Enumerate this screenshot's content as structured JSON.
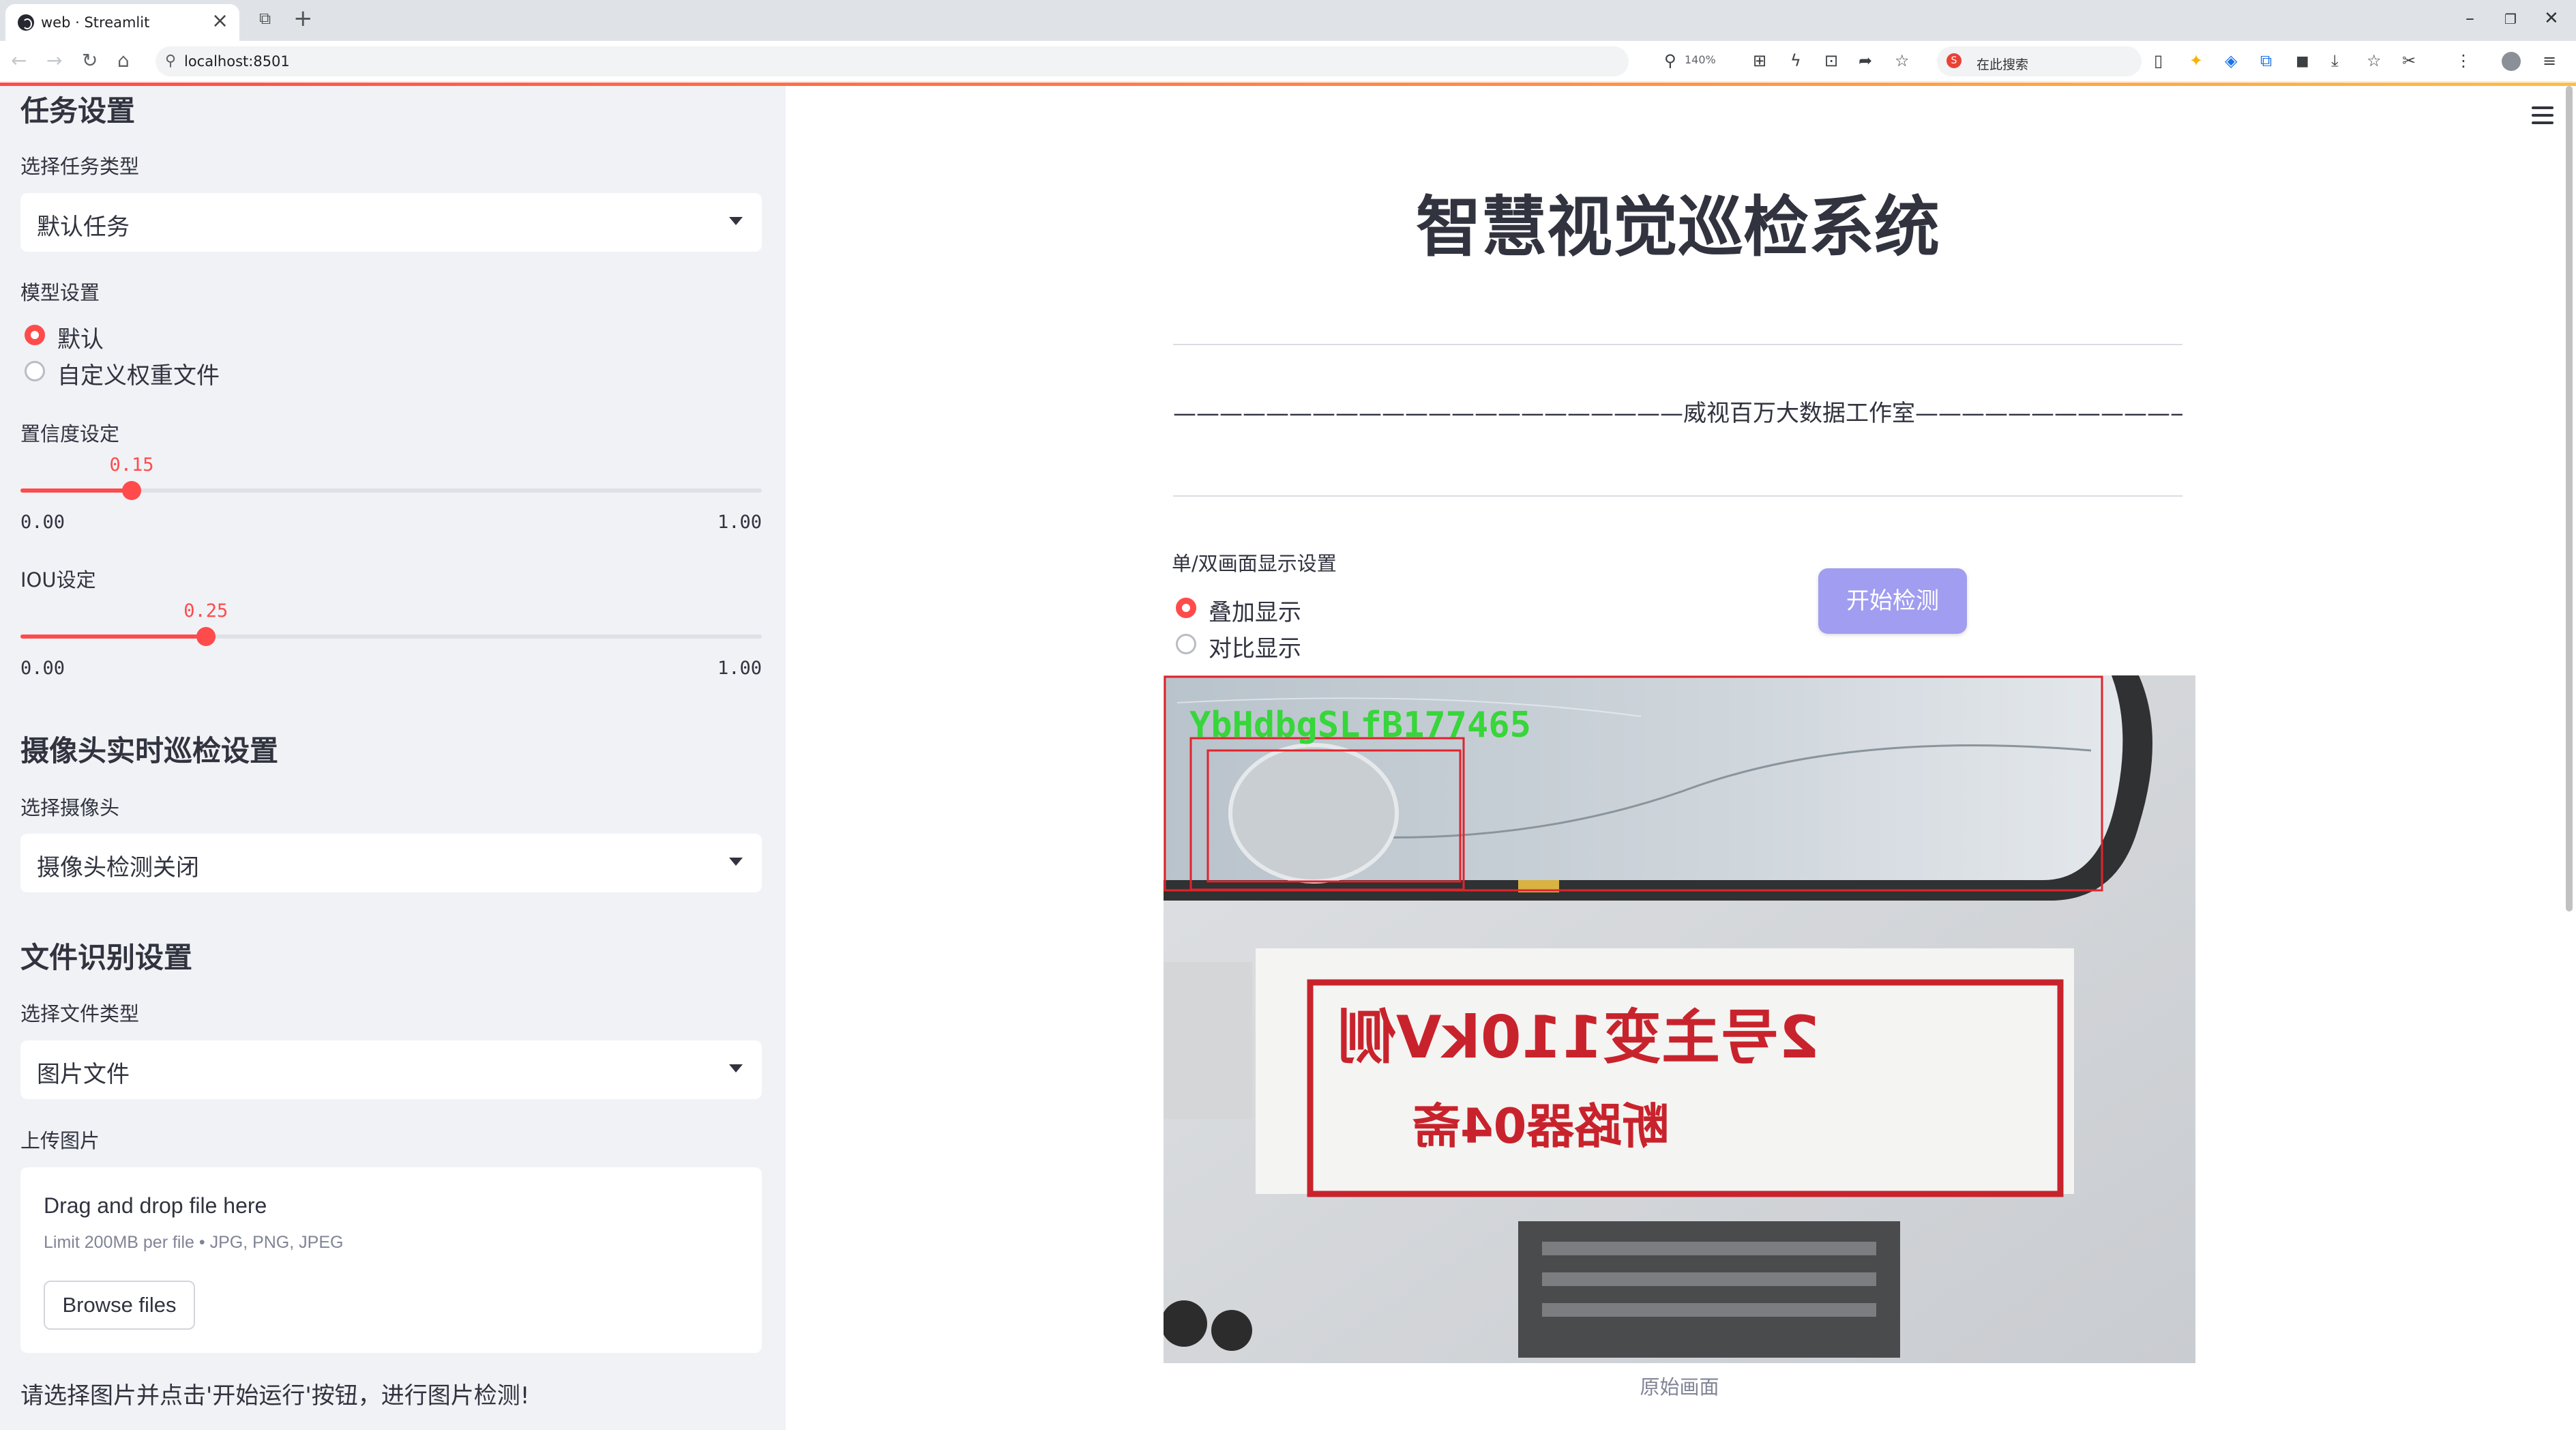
{
  "browser": {
    "tab_title": "web · Streamlit",
    "url": "localhost:8501",
    "zoom": "140%",
    "search_placeholder": "在此搜索"
  },
  "sidebar": {
    "task_section_title": "任务设置",
    "task_type_label": "选择任务类型",
    "task_type_value": "默认任务",
    "model_label": "模型设置",
    "model_options": [
      "默认",
      "自定义权重文件"
    ],
    "model_selected": "默认",
    "confidence": {
      "label": "置信度设定",
      "value": "0.15",
      "fraction": 0.15,
      "min": "0.00",
      "max": "1.00"
    },
    "iou": {
      "label": "IOU设定",
      "value": "0.25",
      "fraction": 0.25,
      "min": "0.00",
      "max": "1.00"
    },
    "camera_section_title": "摄像头实时巡检设置",
    "camera_label": "选择摄像头",
    "camera_value": "摄像头检测关闭",
    "file_section_title": "文件识别设置",
    "file_type_label": "选择文件类型",
    "file_type_value": "图片文件",
    "upload_label": "上传图片",
    "upload_title": "Drag and drop file here",
    "upload_limit": "Limit 200MB per file • JPG, PNG, JPEG",
    "browse_label": "Browse files",
    "hint": "请选择图片并点击'开始运行'按钮，进行图片检测!"
  },
  "main": {
    "title": "智慧视觉巡检系统",
    "subtitle": "——————————————————————威视百万大数据工作室——————————————————————",
    "display_mode_label": "单/双画面显示设置",
    "display_options": [
      "叠加显示",
      "对比显示"
    ],
    "display_selected": "叠加显示",
    "start_button": "开始检测",
    "image_caption": "原始画面",
    "detection_label_text": "YbHdbgSLfB177465",
    "sign_line1": "2号主变110kV侧",
    "sign_line2": "断路器04斋"
  },
  "colors": {
    "accent": "#ff4b4b",
    "button": "#a19df0",
    "sidebar_bg": "#f0f2f6",
    "detection_box": "#e0242c",
    "detection_text": "#37d63a"
  }
}
